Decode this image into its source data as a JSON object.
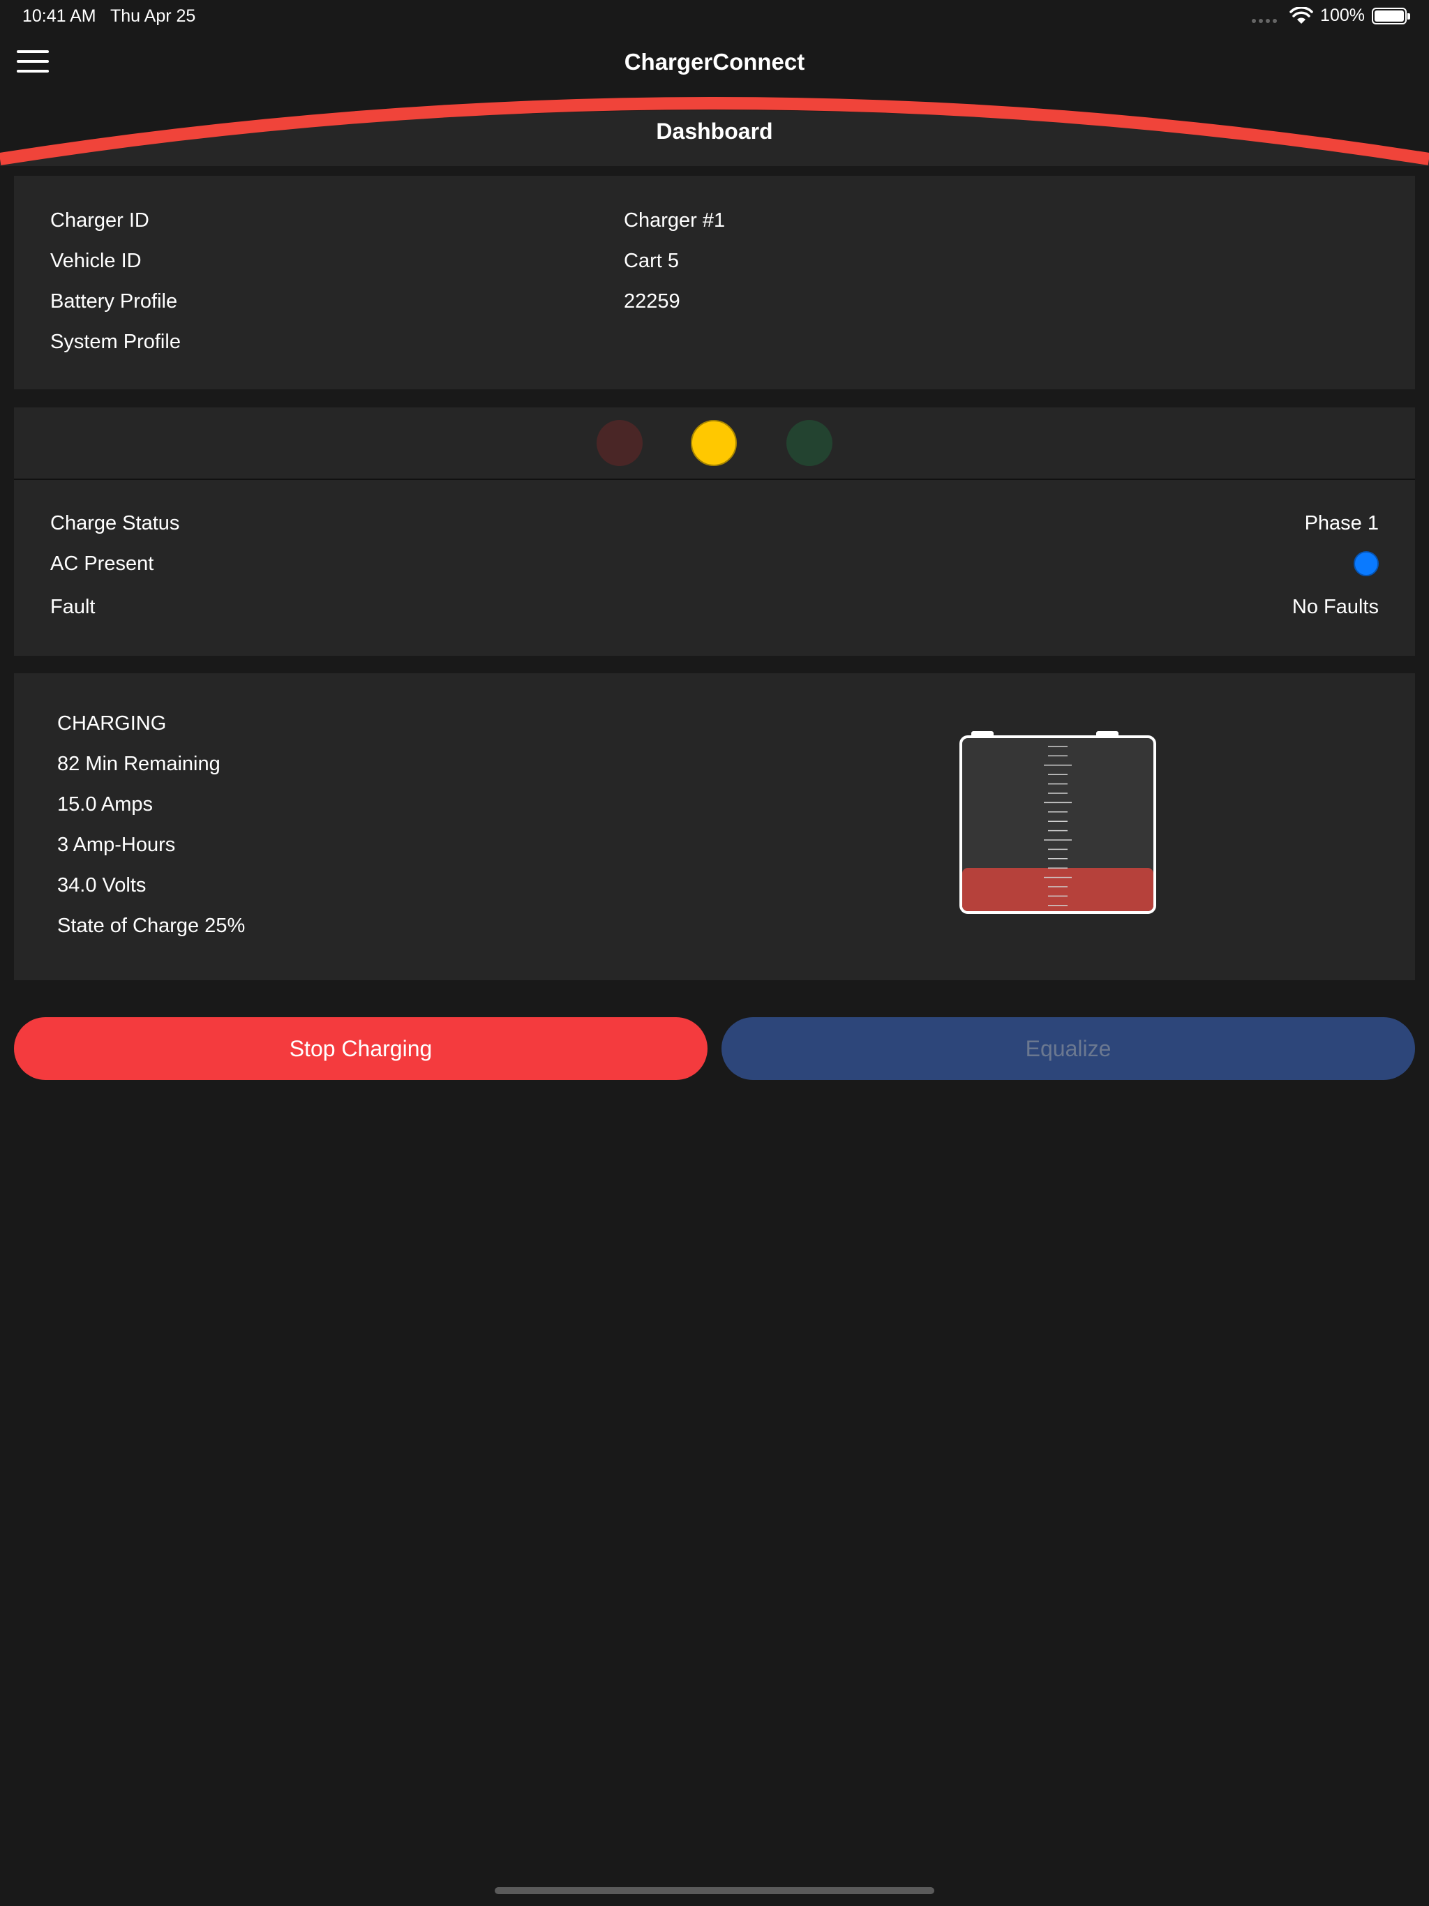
{
  "status_bar": {
    "time": "10:41 AM",
    "date": "Thu Apr 25",
    "battery_percent": "100%"
  },
  "nav": {
    "app_title": "ChargerConnect",
    "page_title": "Dashboard",
    "accent_color": "#f0443a"
  },
  "info": {
    "rows": [
      {
        "label": "Charger ID",
        "value": "Charger #1"
      },
      {
        "label": "Vehicle ID",
        "value": "Cart 5"
      },
      {
        "label": "Battery Profile",
        "value": "22259"
      },
      {
        "label": "System Profile",
        "value": ""
      }
    ]
  },
  "lights": {
    "red_active": false,
    "yellow_active": true,
    "green_active": false
  },
  "status": {
    "charge_status_label": "Charge Status",
    "charge_status_value": "Phase 1",
    "ac_present_label": "AC Present",
    "ac_present_indicator_color": "#0a7aff",
    "fault_label": "Fault",
    "fault_value": "No Faults"
  },
  "charge": {
    "state": "CHARGING",
    "remaining": "82 Min Remaining",
    "amps": "15.0 Amps",
    "amp_hours": "3 Amp-Hours",
    "volts": "34.0 Volts",
    "soc": "State of Charge 25%",
    "soc_fraction": 0.25,
    "fill_color": "#b6413b"
  },
  "buttons": {
    "stop_label": "Stop Charging",
    "equalize_label": "Equalize"
  }
}
